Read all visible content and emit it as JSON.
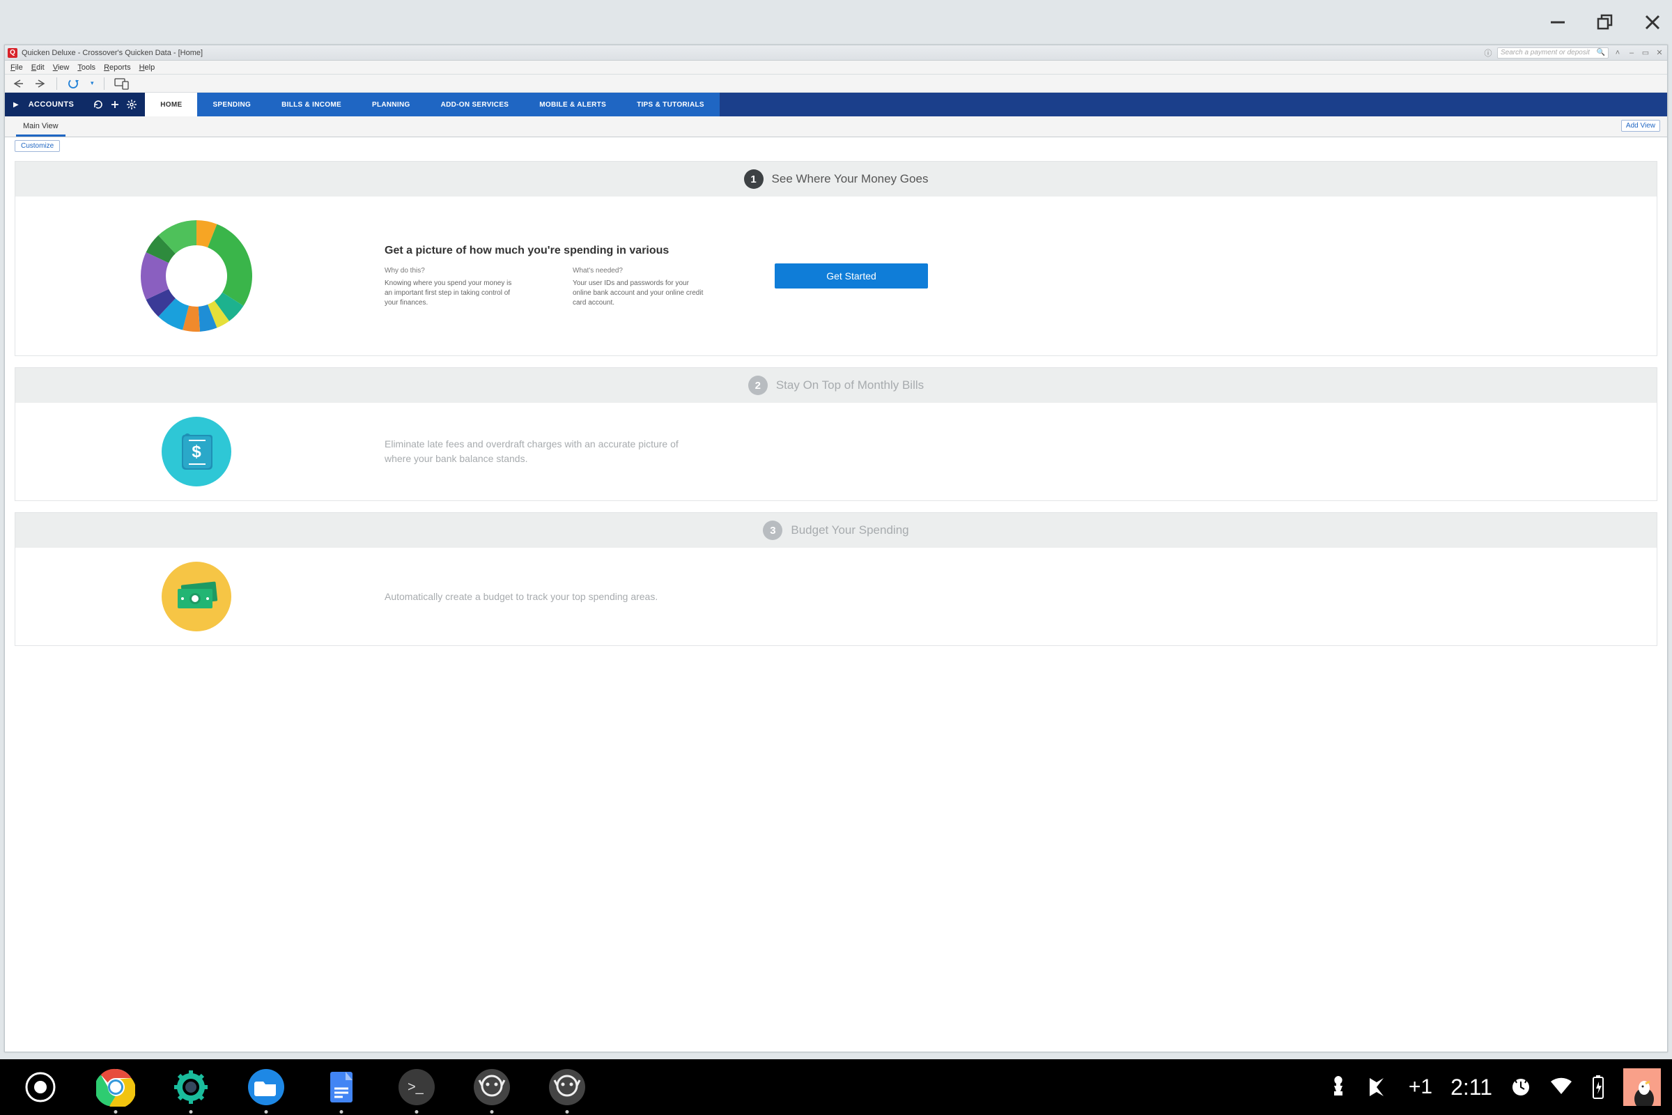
{
  "os": {
    "time": "2:11",
    "plus_badge": "+1"
  },
  "app": {
    "title": "Quicken Deluxe - Crossover's Quicken Data - [Home]",
    "search_placeholder": "Search a payment or deposit"
  },
  "menus": [
    "File",
    "Edit",
    "View",
    "Tools",
    "Reports",
    "Help"
  ],
  "accounts_label": "ACCOUNTS",
  "nav_tabs": [
    "HOME",
    "SPENDING",
    "BILLS & INCOME",
    "PLANNING",
    "ADD-ON SERVICES",
    "MOBILE & ALERTS",
    "TIPS & TUTORIALS"
  ],
  "subtab": "Main View",
  "add_view": "Add View",
  "customize": "Customize",
  "cards": {
    "c1": {
      "num": "1",
      "title": "See Where Your Money Goes",
      "heading": "Get a picture of how much you're spending in various",
      "why_h": "Why do this?",
      "why_p": "Knowing where you spend your money is an important first step in taking control of your finances.",
      "need_h": "What's needed?",
      "need_p": "Your user IDs and passwords for your online bank account and your online credit card account.",
      "cta": "Get Started"
    },
    "c2": {
      "num": "2",
      "title": "Stay On Top of Monthly Bills",
      "body": "Eliminate late fees and overdraft charges with an accurate picture of where your bank balance stands."
    },
    "c3": {
      "num": "3",
      "title": "Budget Your Spending",
      "body": "Automatically create a budget to track your top spending areas."
    }
  },
  "chart_data": {
    "type": "pie",
    "title": "",
    "series": [
      {
        "name": "slice-1",
        "value": 6,
        "color": "#f6a524"
      },
      {
        "name": "slice-2",
        "value": 28,
        "color": "#3ab54a"
      },
      {
        "name": "slice-3",
        "value": 6,
        "color": "#1db28e"
      },
      {
        "name": "slice-4",
        "value": 4,
        "color": "#e5df3a"
      },
      {
        "name": "slice-5",
        "value": 5,
        "color": "#1f8ed6"
      },
      {
        "name": "slice-6",
        "value": 5,
        "color": "#f08a2c"
      },
      {
        "name": "slice-7",
        "value": 8,
        "color": "#1aa0dc"
      },
      {
        "name": "slice-8",
        "value": 6,
        "color": "#3a3a97"
      },
      {
        "name": "slice-9",
        "value": 14,
        "color": "#8a5fc0"
      },
      {
        "name": "slice-10",
        "value": 6,
        "color": "#2e8b3d"
      },
      {
        "name": "slice-11",
        "value": 12,
        "color": "#4ec15a"
      }
    ]
  }
}
